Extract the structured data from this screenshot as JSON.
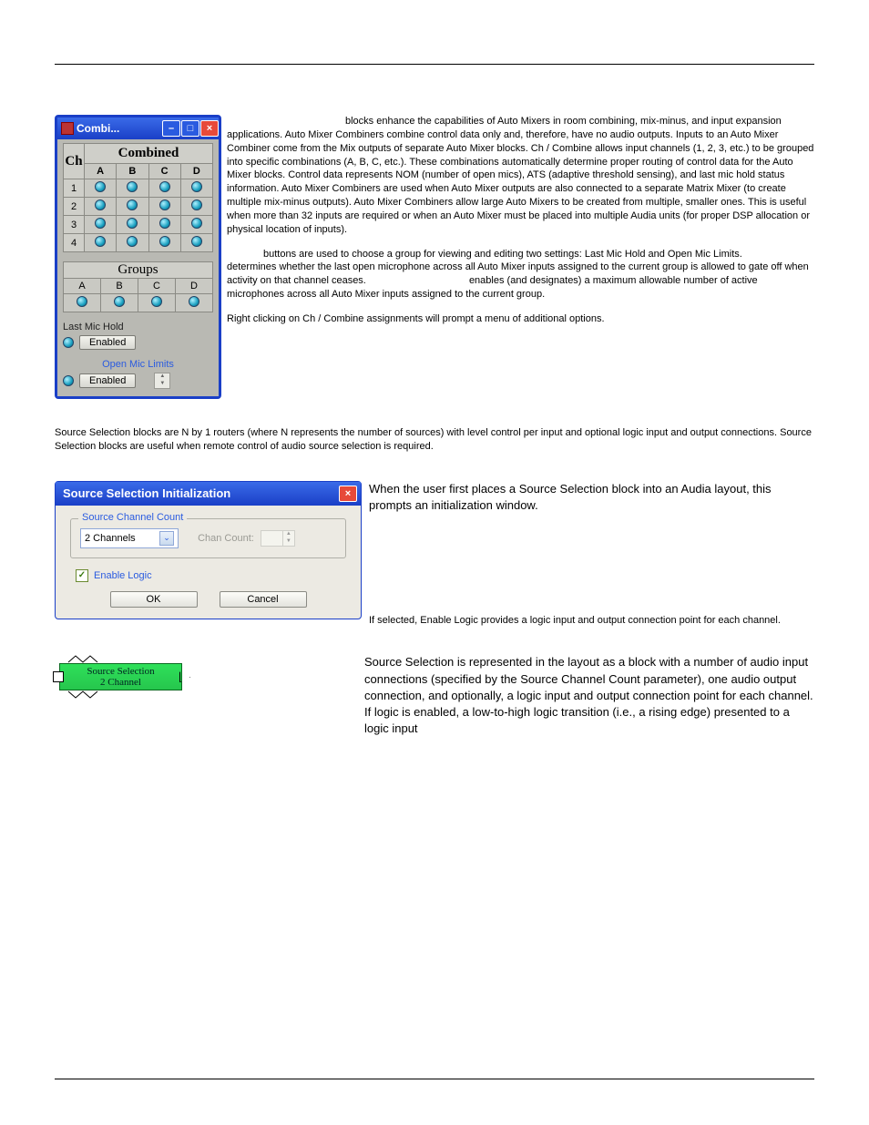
{
  "combi": {
    "title": "Combi...",
    "combined_label": "Combined",
    "ch_label": "Ch",
    "cols": [
      "A",
      "B",
      "C",
      "D"
    ],
    "rows": [
      "1",
      "2",
      "3",
      "4"
    ],
    "groups_label": "Groups",
    "group_cols": [
      "A",
      "B",
      "C",
      "D"
    ],
    "last_mic_hold_label": "Last Mic Hold",
    "enabled_label": "Enabled",
    "open_mic_limits_label": "Open Mic Limits"
  },
  "para1_lead": "blocks enhance the capabilities of Auto Mixers in room combining, mix-minus, and input expansion applications. Auto Mixer Combiners combine control data only and, therefore, have no audio outputs. Inputs to an Auto Mixer Combiner come from the Mix outputs of separate Auto Mixer blocks. Ch / Combine allows input channels (1, 2, 3, etc.) to be grouped into specific combinations (A, B, C, etc.). These combinations automatically determine proper routing of control data for the Auto Mixer blocks. Control data represents NOM (number of open mics), ATS (adaptive threshold sensing), and last mic hold status information. Auto Mixer Combiners are used when Auto Mixer outputs are also connected to a separate Matrix Mixer (to create multiple mix-minus outputs). Auto Mixer Combiners allow large Auto Mixers to be created from multiple, smaller ones. This is useful when more than 32 inputs are required or when an Auto Mixer must be placed into multiple Audia units (for proper DSP allocation or physical location of inputs).",
  "para2": "buttons are used to choose a group for viewing and editing two settings: Last Mic Hold and Open Mic Limits.                             determines whether the last open microphone across all Auto Mixer inputs assigned to the current group is allowed to gate off when activity on that channel ceases.                                     enables (and designates) a maximum allowable number of active microphones across all Auto Mixer inputs assigned to the current group.",
  "para3": "Right clicking on Ch / Combine assignments will prompt a menu of additional options.",
  "section_body": "Source Selection blocks are N by 1 routers (where N represents the number of sources) with level control per input and optional logic input and output connections. Source Selection blocks are useful when remote control of audio source selection is required.",
  "ssi": {
    "title": "Source Selection Initialization",
    "fieldset_legend": "Source Channel Count",
    "combo_value": "2 Channels",
    "chan_count_label": "Chan Count:",
    "enable_logic_label": "Enable Logic",
    "ok": "OK",
    "cancel": "Cancel"
  },
  "ssi_side_text": "When the user first places a Source Selection block into an Audia layout, this prompts an initialization window.",
  "ssi_note": "If selected, Enable Logic provides a logic input and output connection point for each channel.",
  "block": {
    "line1": "Source Selection",
    "line2": "2 Channel"
  },
  "block_side_text": "Source Selection is represented in the layout as a block with a number of audio input connections (specified by the Source Channel Count parameter), one audio output connection, and optionally, a logic input and output connection point for each channel. If logic is enabled, a low-to-high logic transition (i.e., a rising edge) presented to a logic input"
}
